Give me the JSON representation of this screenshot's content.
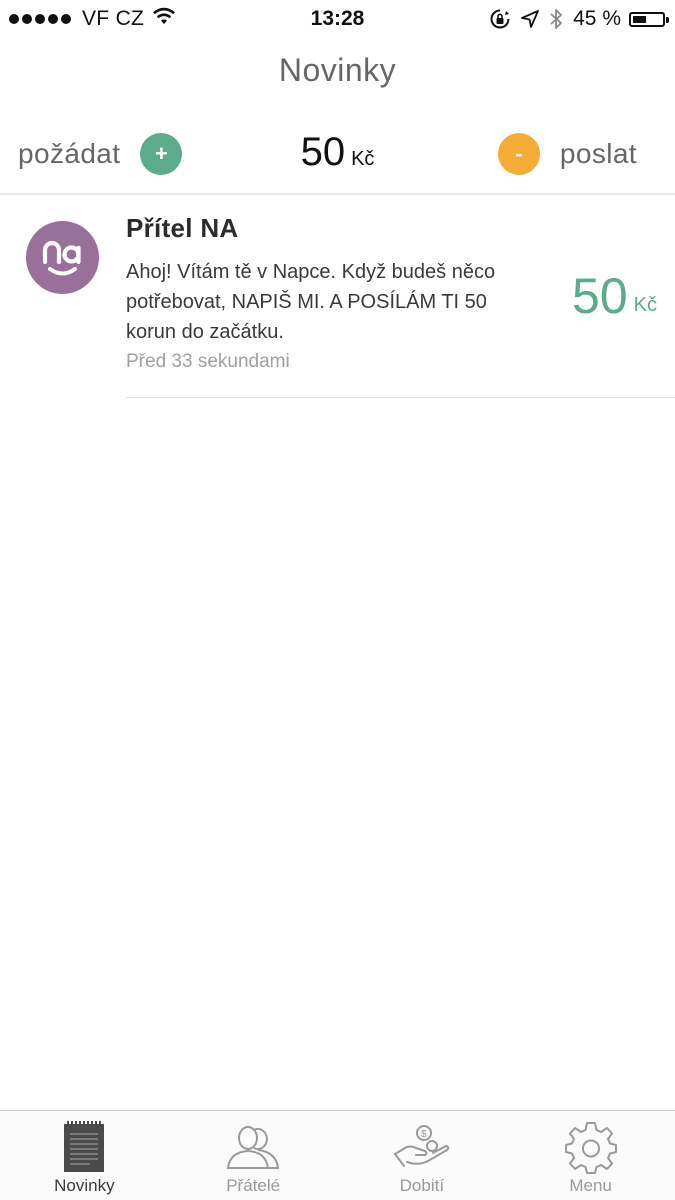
{
  "status_bar": {
    "carrier": "VF CZ",
    "time": "13:28",
    "battery_percent": "45 %",
    "battery_level": 0.45
  },
  "nav": {
    "title": "Novinky"
  },
  "balance_bar": {
    "request_label": "požádat",
    "request_symbol": "+",
    "send_label": "poslat",
    "send_symbol": "-",
    "amount": "50",
    "currency": "Kč",
    "colors": {
      "request": "#5bab8c",
      "send": "#f5ac37"
    }
  },
  "feed": {
    "items": [
      {
        "title": "Přítel NA",
        "text": "Ahoj! Vítám tě v Napce. Když budeš něco potřebovat, NAPIŠ MI. A POSÍLÁM TI 50 korun do začátku.",
        "time": "Před 33 sekundami",
        "amount": "50",
        "currency": "Kč",
        "avatar_color": "#98709a"
      }
    ]
  },
  "tabs": [
    {
      "label": "Novinky",
      "icon": "news-icon",
      "active": true
    },
    {
      "label": "Přátelé",
      "icon": "friends-icon",
      "active": false
    },
    {
      "label": "Dobití",
      "icon": "top-up-icon",
      "active": false
    },
    {
      "label": "Menu",
      "icon": "gear-icon",
      "active": false
    }
  ]
}
